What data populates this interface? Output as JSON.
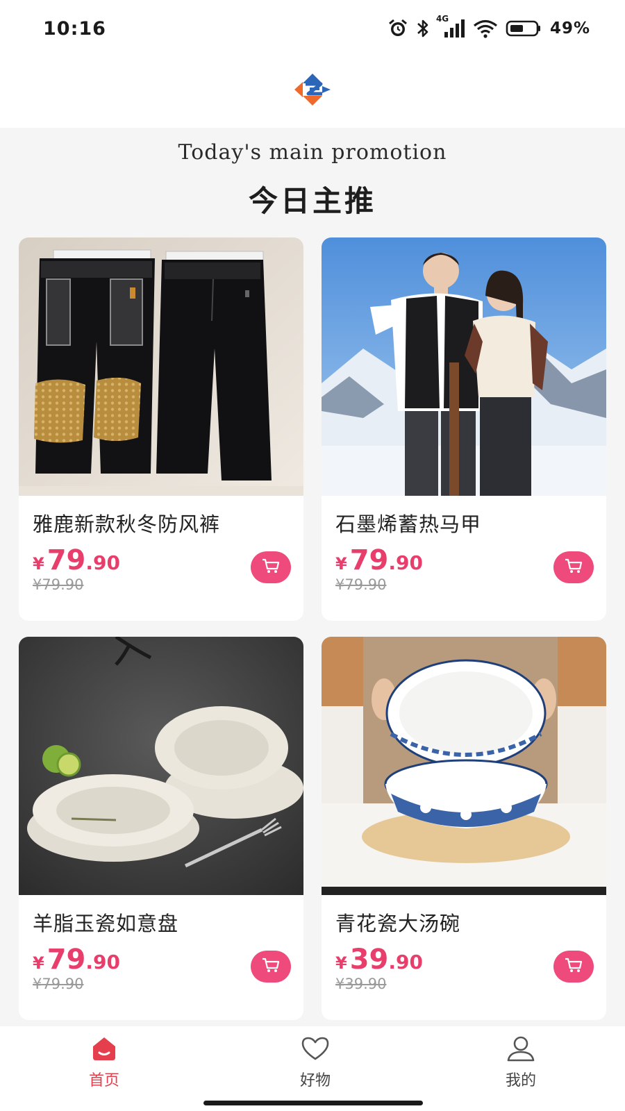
{
  "status_bar": {
    "time": "10:16",
    "network": "4G",
    "battery": "49%",
    "icons": [
      "alarm-icon",
      "bluetooth-icon",
      "signal-icon",
      "wifi-icon",
      "battery-icon"
    ]
  },
  "header": {
    "logo_icon": "brand-logo-icon",
    "logo_colors": [
      "#2c66b8",
      "#ef6a2a"
    ]
  },
  "promo": {
    "title_en": "Today's main promotion",
    "title_cn": "今日主推"
  },
  "accent_color": "#e83e6c",
  "products": [
    {
      "title": "雅鹿新款秋冬防风裤",
      "currency": "¥",
      "price_int": "79",
      "price_dec": ".90",
      "original_price": "¥79.90",
      "image": "black-pants-photo"
    },
    {
      "title": "石墨烯蓄热马甲",
      "currency": "¥",
      "price_int": "79",
      "price_dec": ".90",
      "original_price": "¥79.90",
      "image": "couple-vests-snow-photo"
    },
    {
      "title": "羊脂玉瓷如意盘",
      "currency": "¥",
      "price_int": "79",
      "price_dec": ".90",
      "original_price": "¥79.90",
      "image": "white-plates-photo"
    },
    {
      "title": "青花瓷大汤碗",
      "currency": "¥",
      "price_int": "39",
      "price_dec": ".90",
      "original_price": "¥39.90",
      "image": "blue-white-bowls-photo"
    }
  ],
  "bottom_nav": [
    {
      "label": "首页",
      "icon": "home-icon",
      "active": true
    },
    {
      "label": "好物",
      "icon": "heart-icon",
      "active": false
    },
    {
      "label": "我的",
      "icon": "user-icon",
      "active": false
    }
  ]
}
